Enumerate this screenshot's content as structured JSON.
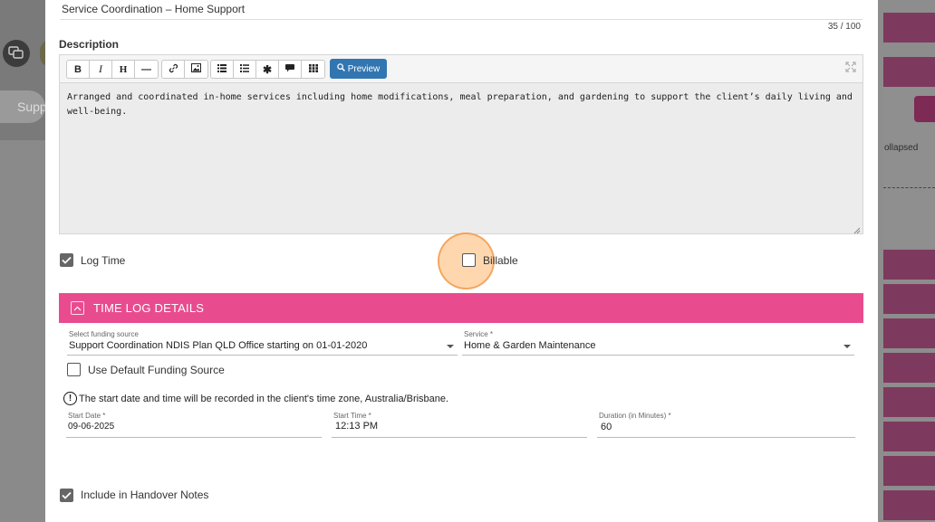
{
  "background": {
    "pill_text": "Supp",
    "collapsed_text": "ollapsed"
  },
  "form": {
    "title_value": "Service Coordination – Home Support",
    "char_count": "35 / 100",
    "description_label": "Description"
  },
  "editor": {
    "toolbar": {
      "bold": "B",
      "italic": "I",
      "heading": "H",
      "hr": "—",
      "preview_label": "Preview"
    },
    "content": "Arranged and coordinated in-home services including home modifications, meal preparation, and gardening to support the client’s daily living and well-being."
  },
  "options": {
    "log_time_label": "Log Time",
    "log_time_checked": true,
    "billable_label": "Billable",
    "billable_checked": false
  },
  "time_log": {
    "section_title": "TIME LOG DETAILS",
    "funding_source_label": "Select funding source",
    "funding_source_value": "Support Coordination NDIS Plan QLD Office starting on 01-01-2020",
    "service_label": "Service *",
    "service_value": "Home & Garden Maintenance",
    "use_default_label": "Use Default Funding Source",
    "use_default_checked": false,
    "timezone_note": "The start date and time will be recorded in the client's time zone, Australia/Brisbane.",
    "start_date_label": "Start Date *",
    "start_date_value": "09-06-2025",
    "start_time_label": "Start Time *",
    "start_time_value": "12:13 PM",
    "duration_label": "Duration (in Minutes) *",
    "duration_value": "60"
  },
  "handover": {
    "label": "Include in Handover Notes",
    "checked": true
  },
  "colors": {
    "section_header": "#e84c8f",
    "preview_button": "#3276b1",
    "background_accent": "#7d3a5e",
    "highlight": "#ffb76e"
  }
}
